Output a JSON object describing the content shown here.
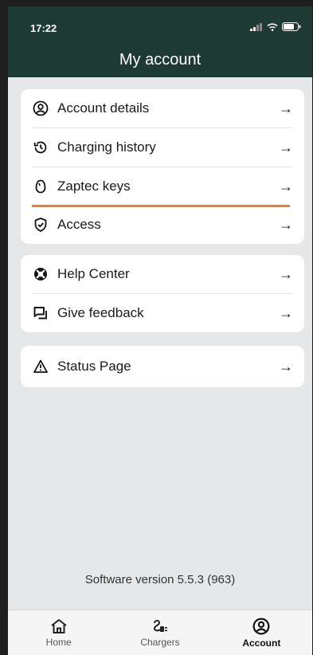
{
  "status_bar": {
    "time": "17:22",
    "icons": [
      "signal-icon",
      "wifi-icon",
      "battery-icon"
    ]
  },
  "header": {
    "title": "My account"
  },
  "groups": [
    {
      "items": [
        {
          "label": "Account details",
          "icon": "user-circle-icon",
          "arrow": "→"
        },
        {
          "label": "Charging history",
          "icon": "history-icon",
          "arrow": "→"
        },
        {
          "label": "Zaptec keys",
          "icon": "key-icon",
          "arrow": "→"
        },
        {
          "label": "Access",
          "icon": "shield-check-icon",
          "arrow": "→"
        }
      ]
    },
    {
      "items": [
        {
          "label": "Help Center",
          "icon": "lifebuoy-icon",
          "arrow": "→"
        },
        {
          "label": "Give feedback",
          "icon": "feedback-icon",
          "arrow": "→"
        }
      ]
    },
    {
      "items": [
        {
          "label": "Status Page",
          "icon": "warning-icon",
          "arrow": "→"
        }
      ]
    }
  ],
  "footer": {
    "version": "Software version 5.5.3 (963)"
  },
  "tabbar": [
    {
      "label": "Home",
      "icon": "home-icon",
      "active": false
    },
    {
      "label": "Chargers",
      "icon": "charger-icon",
      "active": false
    },
    {
      "label": "Account",
      "icon": "user-circle-icon",
      "active": true
    }
  ],
  "colors": {
    "header_bg": "#1d3a33",
    "accent": "#ee7b2c",
    "page_bg": "#e6e7e8"
  }
}
